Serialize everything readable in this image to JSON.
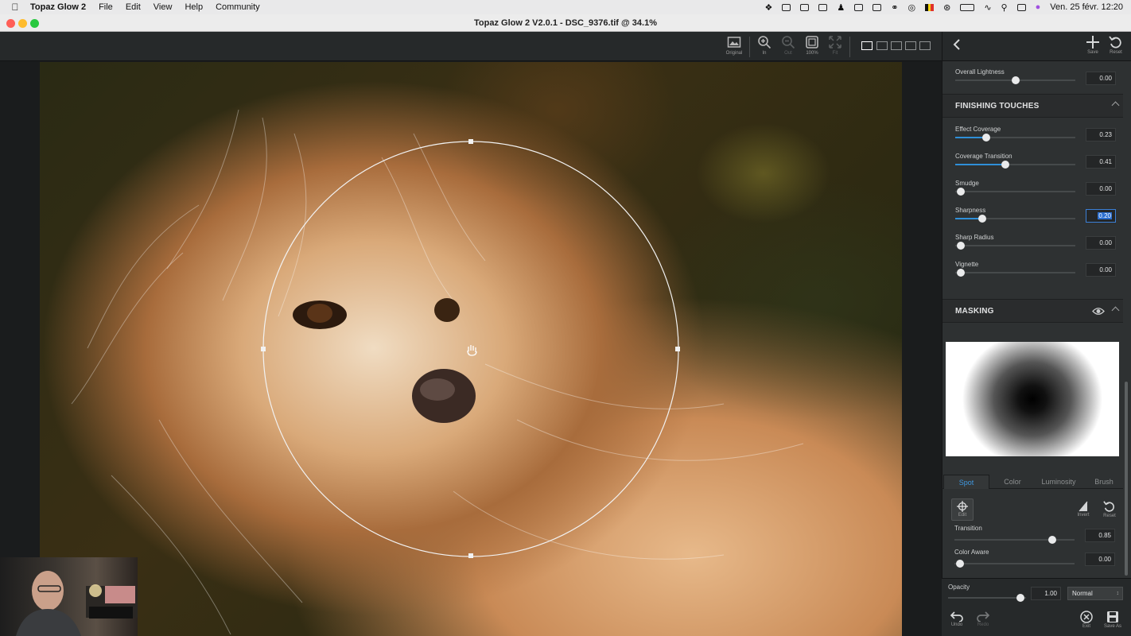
{
  "menubar": {
    "app_name": "Topaz Glow 2",
    "menus": [
      "File",
      "Edit",
      "View",
      "Help",
      "Community"
    ],
    "datetime": "Ven. 25 févr.  12:20"
  },
  "window": {
    "title": "Topaz Glow 2 V2.0.1 - DSC_9376.tif @ 34.1%"
  },
  "toolbar": {
    "original_label": "Original",
    "zoom_in_label": "In",
    "zoom_out_label": "Out",
    "zoom_100_label": "100%",
    "fit_label": "Fit"
  },
  "panel": {
    "save_label": "Save",
    "reset_label": "Reset",
    "overall_lightness": {
      "label": "Overall Lightness",
      "value": "0.00",
      "level": 0.5
    },
    "finishing": {
      "title": "FINISHING TOUCHES",
      "sliders": [
        {
          "label": "Effect Coverage",
          "value": "0.23",
          "level": 0.23
        },
        {
          "label": "Coverage Transition",
          "value": "0.41",
          "level": 0.41
        },
        {
          "label": "Smudge",
          "value": "0.00",
          "level": 0.0
        },
        {
          "label": "Sharpness",
          "value": "0.20",
          "level": 0.2
        },
        {
          "label": "Sharp Radius",
          "value": "0.00",
          "level": 0.0
        },
        {
          "label": "Vignette",
          "value": "0.00",
          "level": 0.0
        }
      ]
    },
    "masking": {
      "title": "MASKING",
      "tabs": [
        "Spot",
        "Color",
        "Luminosity",
        "Brush"
      ],
      "active_tab": "Spot",
      "edit_label": "Edit",
      "invert_label": "Invert",
      "reset_label": "Reset",
      "transition": {
        "label": "Transition",
        "value": "0.85",
        "level": 0.85
      },
      "color_aware": {
        "label": "Color Aware",
        "value": "0.00",
        "level": 0.0
      }
    },
    "opacity": {
      "label": "Opacity",
      "value": "1.00",
      "level": 1.0
    },
    "blend_mode": "Normal",
    "undo_label": "Undo",
    "redo_label": "Redo",
    "exit_label": "Exit",
    "save_as_label": "Save As"
  },
  "colors": {
    "accent": "#2f8fd8",
    "panel_bg": "#2e3132",
    "toolbar_bg": "#26292a"
  }
}
